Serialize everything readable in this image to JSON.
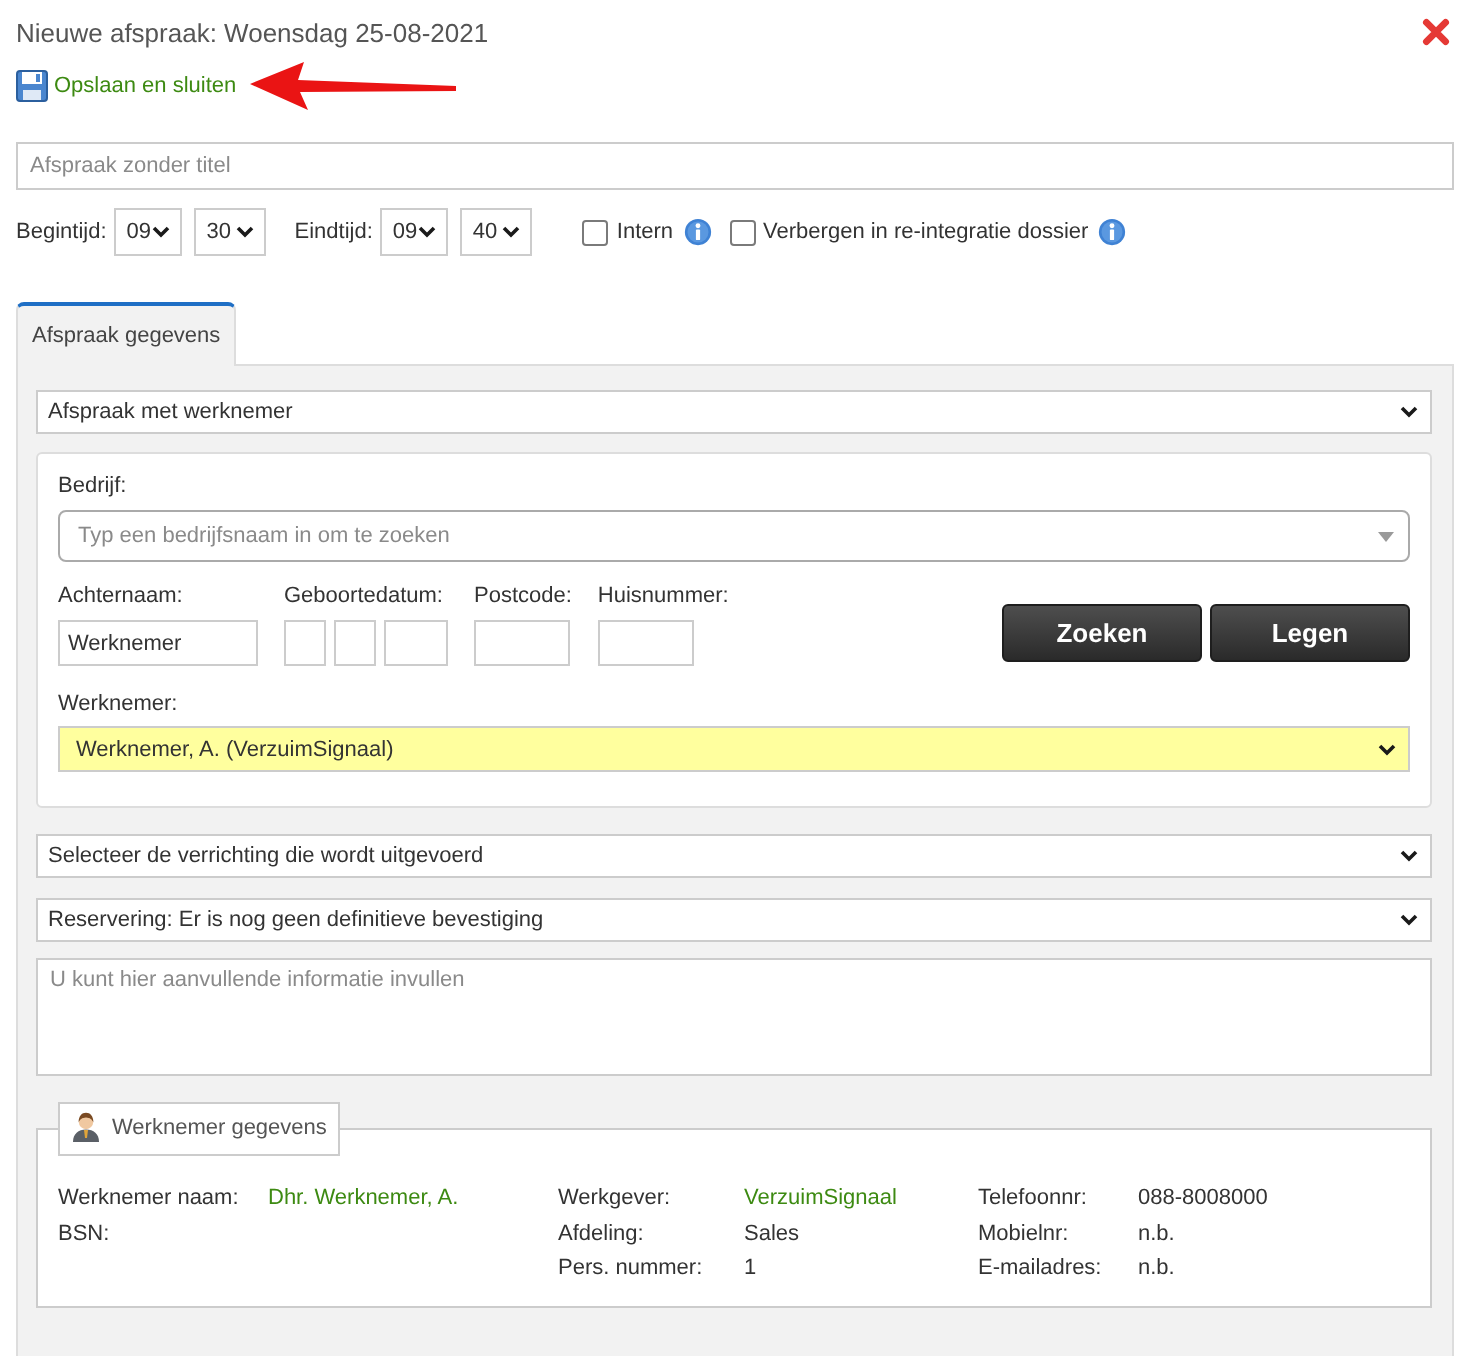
{
  "window": {
    "title": "Nieuwe afspraak: Woensdag 25-08-2021"
  },
  "toolbar": {
    "save_label": "Opslaan en sluiten"
  },
  "annotations": [
    {
      "kind": "arrow"
    }
  ],
  "title_field": {
    "placeholder": "Afspraak zonder titel"
  },
  "times": [
    {
      "label": "Begintijd:",
      "hour": "09",
      "minute": "30"
    },
    {
      "label": "Eindtijd:",
      "hour": "09",
      "minute": "40"
    }
  ],
  "options": [
    {
      "label": "Intern",
      "checked": false
    },
    {
      "label": "Verbergen in re-integratie dossier",
      "checked": false
    }
  ],
  "tabs": [
    {
      "label": "Afspraak gegevens",
      "selected": true
    }
  ],
  "appointment_type": {
    "value": "Afspraak met werknemer"
  },
  "search": {
    "company": {
      "label": "Bedrijf:",
      "placeholder": "Typ een bedrijfsnaam in om te zoeken"
    },
    "fields": [
      {
        "label": "Achternaam:",
        "kind": "text",
        "value": "Werknemer"
      },
      {
        "label": "Geboortedatum:",
        "kind": "date"
      },
      {
        "label": "Postcode:",
        "kind": "text"
      },
      {
        "label": "Huisnummer:",
        "kind": "text"
      }
    ],
    "buttons": [
      "Zoeken",
      "Legen"
    ],
    "employee": {
      "label": "Werknemer:",
      "value": "Werknemer, A. (VerzuimSignaal)",
      "highlighted": true
    }
  },
  "activity": {
    "value": "Selecteer de verrichting die wordt uitgevoerd"
  },
  "reservation": {
    "value": "Reservering: Er is nog geen definitieve bevestiging"
  },
  "notes": {
    "placeholder": "U kunt hier aanvullende informatie invullen"
  },
  "employee_details": {
    "title": "Werknemer gegevens",
    "columns": [
      [
        {
          "label": "Werknemer naam:",
          "value": "Dhr. Werknemer, A.",
          "link": true
        },
        {
          "label": "BSN:"
        }
      ],
      [
        {
          "label": "Werkgever:",
          "value": "VerzuimSignaal",
          "link": true
        },
        {
          "label": "Afdeling:",
          "value": "Sales",
          "link": false
        },
        {
          "label": "Pers. nummer:",
          "value": "1",
          "link": false
        }
      ],
      [
        {
          "label": "Telefoonnr:",
          "value": "088-8008000",
          "link": false
        },
        {
          "label": "Mobielnr:",
          "value": "n.b.",
          "link": false
        },
        {
          "label": "E-mailadres:",
          "value": "n.b.",
          "link": false
        }
      ]
    ]
  }
}
